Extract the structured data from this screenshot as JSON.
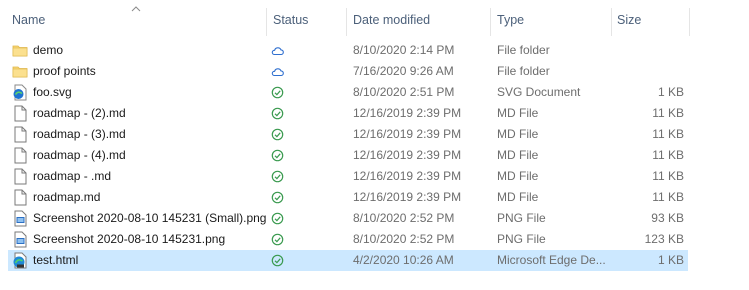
{
  "columns": {
    "name": "Name",
    "status": "Status",
    "date": "Date modified",
    "type": "Type",
    "size": "Size"
  },
  "files": [
    {
      "icon": "folder-icon",
      "status_icon": "cloud-icon",
      "name": "demo",
      "date": "8/10/2020 2:14 PM",
      "type": "File folder",
      "size": ""
    },
    {
      "icon": "folder-icon",
      "status_icon": "cloud-icon",
      "name": "proof points",
      "date": "7/16/2020 9:26 AM",
      "type": "File folder",
      "size": ""
    },
    {
      "icon": "svg-file-icon",
      "status_icon": "synced-check-icon",
      "name": "foo.svg",
      "date": "8/10/2020 2:51 PM",
      "type": "SVG Document",
      "size": "1 KB"
    },
    {
      "icon": "document-icon",
      "status_icon": "synced-check-icon",
      "name": "roadmap -  (2).md",
      "date": "12/16/2019 2:39 PM",
      "type": "MD File",
      "size": "11 KB"
    },
    {
      "icon": "document-icon",
      "status_icon": "synced-check-icon",
      "name": "roadmap -  (3).md",
      "date": "12/16/2019 2:39 PM",
      "type": "MD File",
      "size": "11 KB"
    },
    {
      "icon": "document-icon",
      "status_icon": "synced-check-icon",
      "name": "roadmap -  (4).md",
      "date": "12/16/2019 2:39 PM",
      "type": "MD File",
      "size": "11 KB"
    },
    {
      "icon": "document-icon",
      "status_icon": "synced-check-icon",
      "name": "roadmap - .md",
      "date": "12/16/2019 2:39 PM",
      "type": "MD File",
      "size": "11 KB"
    },
    {
      "icon": "document-icon",
      "status_icon": "synced-check-icon",
      "name": "roadmap.md",
      "date": "12/16/2019 2:39 PM",
      "type": "MD File",
      "size": "11 KB"
    },
    {
      "icon": "image-file-icon",
      "status_icon": "synced-check-icon",
      "name": "Screenshot 2020-08-10 145231 (Small).png",
      "date": "8/10/2020 2:52 PM",
      "type": "PNG File",
      "size": "93 KB"
    },
    {
      "icon": "image-file-icon",
      "status_icon": "synced-check-icon",
      "name": "Screenshot 2020-08-10 145231.png",
      "date": "8/10/2020 2:52 PM",
      "type": "PNG File",
      "size": "123 KB"
    },
    {
      "icon": "edge-html-icon",
      "status_icon": "synced-check-icon",
      "name": "test.html",
      "date": "4/2/2020 10:26 AM",
      "type": "Microsoft Edge De...",
      "size": "1 KB",
      "selected": true
    }
  ],
  "colors": {
    "selection": "#cce8ff",
    "header_text": "#4c607a",
    "sync_green": "#3a9a4f",
    "cloud_blue": "#2f6fcf",
    "folder_yellow": "#f8d775"
  }
}
